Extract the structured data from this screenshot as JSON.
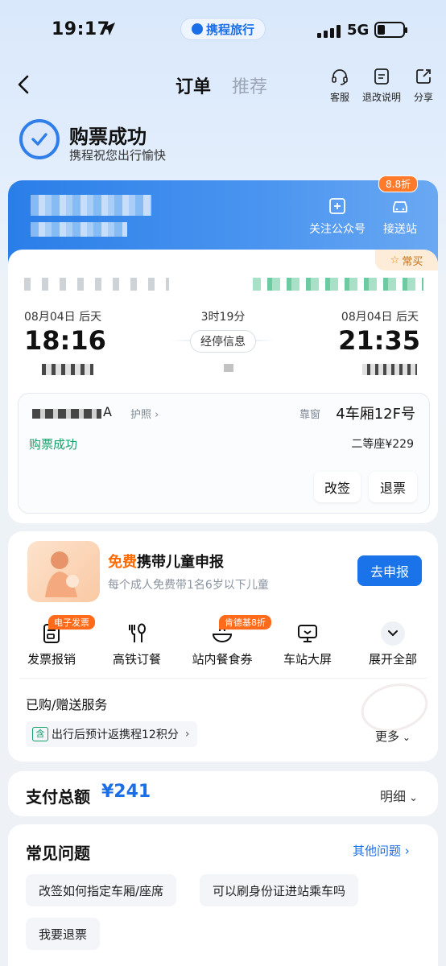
{
  "status_bar": {
    "time": "19:17",
    "brand": "携程旅行",
    "network": "5G"
  },
  "nav": {
    "tab_active": "订单",
    "tab_inactive": "推荐",
    "tools": [
      {
        "label": "客服",
        "icon": "headset-icon"
      },
      {
        "label": "退改说明",
        "icon": "document-icon"
      },
      {
        "label": "分享",
        "icon": "share-icon"
      }
    ]
  },
  "success": {
    "title": "购票成功",
    "subtitle": "携程祝您出行愉快"
  },
  "blue_card": {
    "tools": [
      {
        "label": "关注公众号",
        "icon": "plus-square-icon"
      },
      {
        "label": "接送站",
        "icon": "car-icon",
        "badge": "8.8折"
      }
    ]
  },
  "ticket": {
    "often_tag": "常买",
    "depart_date": "08月04日  后天",
    "arrive_date": "08月04日  后天",
    "duration": "3时19分",
    "depart_time": "18:16",
    "arrive_time": "21:35",
    "stop_info": "经停信息",
    "passenger_name_suffix": "A",
    "passport": "护照 ›",
    "window": "靠窗",
    "seat": "4车厢12F号",
    "status": "购票成功",
    "seat_class": "二等座¥229",
    "change_btn": "改签",
    "refund_btn": "退票"
  },
  "child": {
    "title_free": "免费",
    "title_rest": "携带儿童申报",
    "subtitle": "每个成人免费带1名6岁以下儿童",
    "button": "去申报"
  },
  "services": [
    {
      "label": "发票报销",
      "icon": "invoice-icon",
      "badge": "电子发票"
    },
    {
      "label": "高铁订餐",
      "icon": "fork-spoon-icon"
    },
    {
      "label": "站内餐食券",
      "icon": "food-coupon-icon",
      "badge": "肯德基8折"
    },
    {
      "label": "车站大屏",
      "icon": "screen-icon"
    },
    {
      "label": "展开全部",
      "icon": "chevron-down-icon"
    }
  ],
  "bought": {
    "title": "已购/赠送服务",
    "tag": "含",
    "points": "出行后预计返携程12积分",
    "more": "更多"
  },
  "payment": {
    "label": "支付总额",
    "amount": "¥241",
    "detail": "明细"
  },
  "faq": {
    "title": "常见问题",
    "more": "其他问题",
    "items": [
      "改签如何指定车厢/座席",
      "可以刷身份证进站乘车吗",
      "我要退票"
    ]
  },
  "colors": {
    "accent": "#1a6ee6",
    "success": "#16a06a",
    "promo": "#ff6b1a"
  }
}
